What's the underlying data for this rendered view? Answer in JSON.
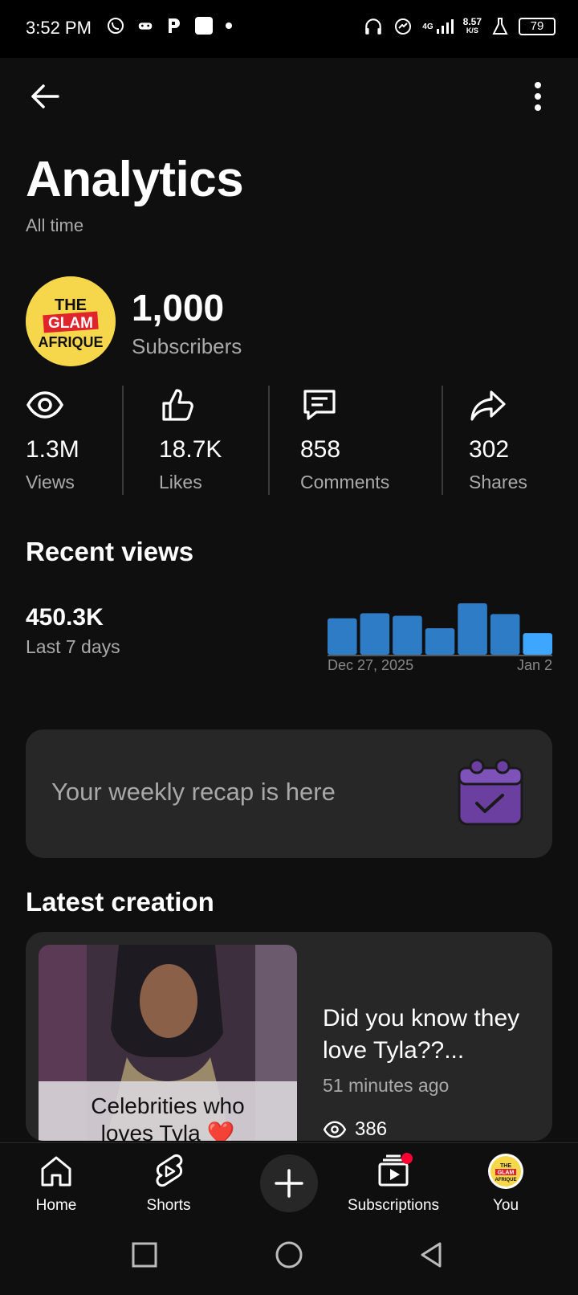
{
  "status_bar": {
    "time": "3:52 PM",
    "net_type": "4G",
    "net_speed": "8.57",
    "net_unit": "K/S",
    "battery": "79"
  },
  "header": {
    "title": "Analytics",
    "period": "All time"
  },
  "channel": {
    "subscribers_count": "1,000",
    "subscribers_label": "Subscribers",
    "avatar_lettering": [
      "THE",
      "GLAM",
      "AFRIQUE"
    ]
  },
  "stats": [
    {
      "icon": "eye-icon",
      "value": "1.3M",
      "label": "Views"
    },
    {
      "icon": "thumbs-up-icon",
      "value": "18.7K",
      "label": "Likes"
    },
    {
      "icon": "comment-icon",
      "value": "858",
      "label": "Comments"
    },
    {
      "icon": "share-icon",
      "value": "302",
      "label": "Shares"
    }
  ],
  "recent_views": {
    "section_title": "Recent views",
    "value": "450.3K",
    "label": "Last 7 days",
    "chart_start": "Dec 27, 2025",
    "chart_end": "Jan 2"
  },
  "chart_data": {
    "type": "bar",
    "values": [
      44,
      50,
      47,
      32,
      62,
      49,
      26
    ],
    "colors": [
      "#2f7cc6",
      "#2f7cc6",
      "#2f7cc6",
      "#2f7cc6",
      "#2f7cc6",
      "#2f7cc6",
      "#3ea6ff"
    ]
  },
  "recap": {
    "text": "Your weekly recap is here",
    "icon": "calendar-check-icon"
  },
  "latest": {
    "section_title": "Latest creation",
    "thumb_caption_line1": "Celebrities who",
    "thumb_caption_line2": "loves Tyla ❤️",
    "title": "Did you know they love Tyla??...",
    "time": "51 minutes ago",
    "views": "386"
  },
  "nav": {
    "home": "Home",
    "shorts": "Shorts",
    "subscriptions": "Subscriptions",
    "you": "You"
  },
  "colors": {
    "background": "#0f0f0f",
    "card": "#272727",
    "bar": "#2f7cc6",
    "bar_highlight": "#3ea6ff",
    "accent_red": "#ff0033"
  }
}
